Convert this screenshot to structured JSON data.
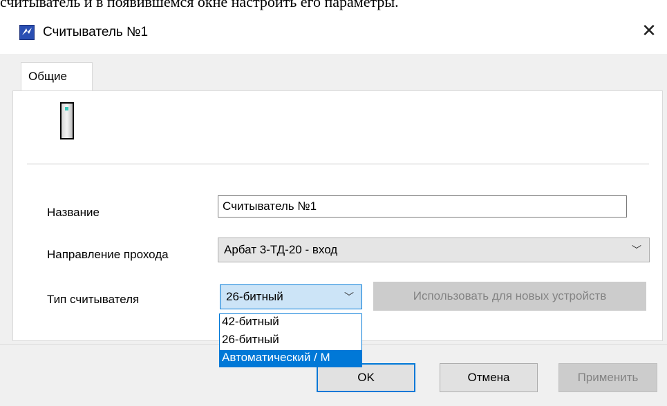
{
  "page_caption": "считыватель и в появившемся окне настроить его параметры.",
  "window": {
    "title": "Считыватель №1",
    "close_glyph": "✕",
    "app_icon": "app-logo-icon"
  },
  "tabs": [
    {
      "label": "Общие",
      "active": true
    }
  ],
  "device_icon": "card-reader-icon",
  "form": {
    "name_label": "Название",
    "name_value": "Считыватель №1",
    "direction_label": "Направление прохода",
    "direction_value": "Арбат 3-ТД-20 - вход",
    "reader_type_label": "Тип считывателя",
    "reader_type_value": "26-битный",
    "use_for_new_label": "Использовать для новых устройств",
    "dropdown_arrow_glyph": "﹀"
  },
  "reader_type_options": [
    {
      "label": "42-битный",
      "selected": false
    },
    {
      "label": "26-битный",
      "selected": false
    },
    {
      "label": "Автоматический / М",
      "selected": true
    }
  ],
  "buttons": {
    "ok": "OK",
    "cancel": "Отмена",
    "apply": "Применить"
  },
  "colors": {
    "accent": "#0078d7",
    "selection_bg": "#cce4f7",
    "disabled_text": "#838383"
  }
}
